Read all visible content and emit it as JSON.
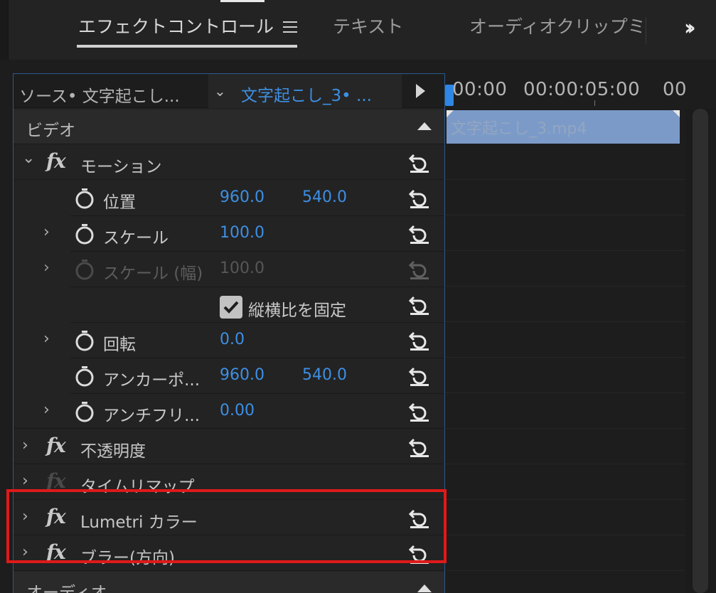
{
  "tabs": {
    "effect_controls": "エフェクトコントロール",
    "text": "テキスト",
    "audio_mixer": "オーディオクリップミキ"
  },
  "source": {
    "source_label": "ソース• 文字起こし...",
    "clip_label": "文字起こし_3• ..."
  },
  "sections": {
    "video": "ビデオ",
    "audio": "オーディオ"
  },
  "effects": {
    "motion": "モーション",
    "opacity": "不透明度",
    "time_remap": "タイムリマップ",
    "lumetri": "Lumetri カラー",
    "blur": "ブラー(方向)"
  },
  "fx_symbol": "fx",
  "properties": {
    "position": {
      "label": "位置",
      "x": "960.0",
      "y": "540.0"
    },
    "scale": {
      "label": "スケール",
      "value": "100.0"
    },
    "scale_width": {
      "label": "スケール (幅)",
      "value": "100.0"
    },
    "uniform_scale": {
      "label": "縦横比を固定",
      "checked": true
    },
    "rotation": {
      "label": "回転",
      "value": "0.0"
    },
    "anchor": {
      "label": "アンカーポ...",
      "x": "960.0",
      "y": "540.0"
    },
    "anti_flicker": {
      "label": "アンチフリ...",
      "value": "0.00"
    }
  },
  "timeline": {
    "time_start": "00:00",
    "time_mid": "00:00:05:00",
    "time_end": "00",
    "clip_name": "文字起こし_3.mp4"
  },
  "colors": {
    "accent_blue": "#3d8fe4",
    "highlight_red": "#e01919",
    "clip_blue": "#7b9ac8"
  }
}
